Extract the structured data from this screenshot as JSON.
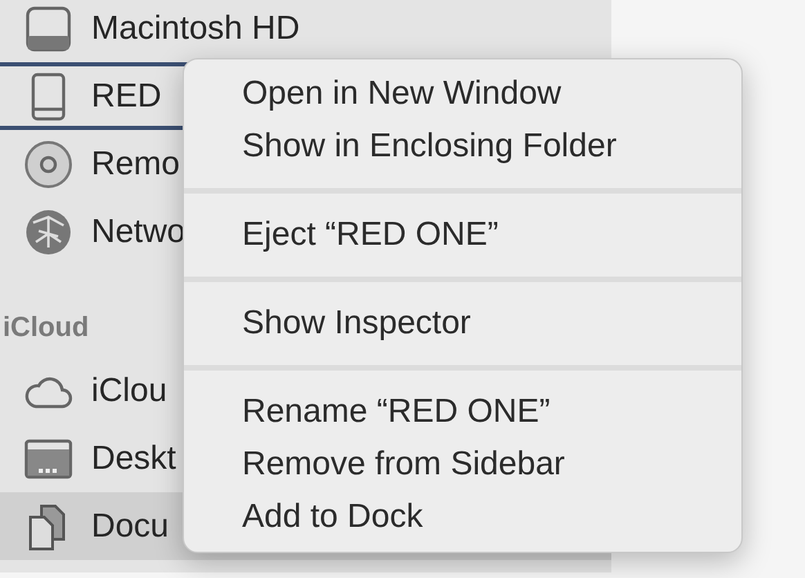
{
  "sidebar": {
    "items": [
      {
        "kind": "disk",
        "label": "Macintosh HD",
        "selected": false,
        "outlined": false
      },
      {
        "kind": "drive",
        "label": "RED",
        "selected": false,
        "outlined": true
      },
      {
        "kind": "disc",
        "label": "Remo",
        "selected": false,
        "outlined": false
      },
      {
        "kind": "network",
        "label": "Netwo",
        "selected": false,
        "outlined": false
      },
      {
        "kind": "header",
        "label": "iCloud"
      },
      {
        "kind": "cloud",
        "label": "iClou",
        "selected": false,
        "outlined": false
      },
      {
        "kind": "desktop",
        "label": "Deskt",
        "selected": false,
        "outlined": false
      },
      {
        "kind": "documents",
        "label": "Docu",
        "selected": true,
        "outlined": false
      }
    ]
  },
  "context_menu": {
    "groups": [
      [
        "Open in New Window",
        "Show in Enclosing Folder"
      ],
      [
        "Eject “RED ONE”"
      ],
      [
        "Show Inspector"
      ],
      [
        "Rename “RED ONE”",
        "Remove from Sidebar",
        "Add to Dock"
      ]
    ]
  }
}
